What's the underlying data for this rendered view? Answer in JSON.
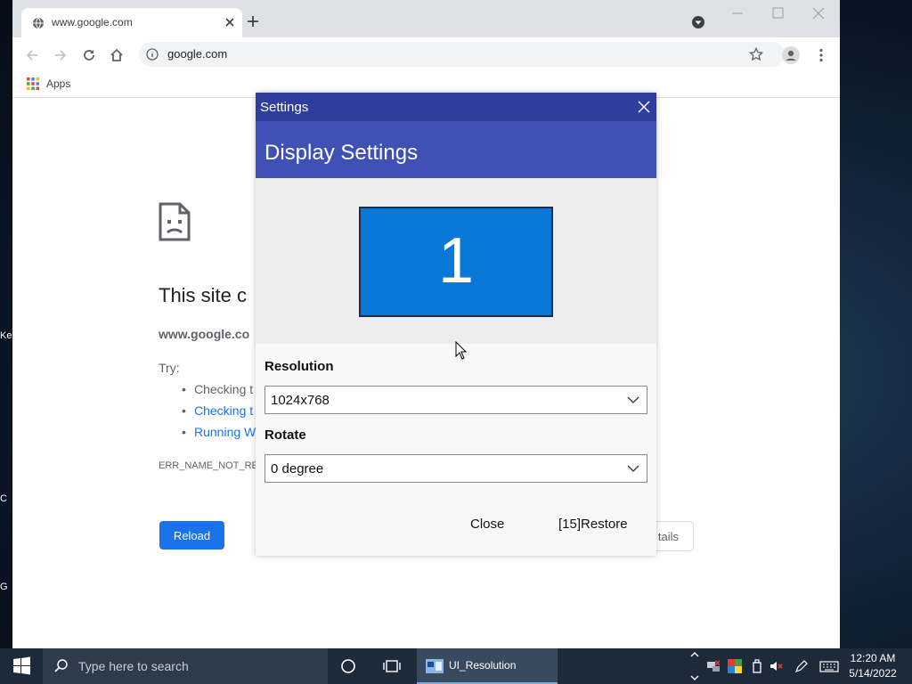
{
  "browser": {
    "tab_title": "www.google.com",
    "url": "google.com",
    "bookmarks": {
      "apps_label": "Apps"
    }
  },
  "error_page": {
    "title": "This site c",
    "host": "www.google.co",
    "try_label": "Try:",
    "suggestions": [
      "Checking t",
      "Checking t",
      "Running W"
    ],
    "error_code": "ERR_NAME_NOT_RES",
    "reload_label": "Reload",
    "details_label": "tails"
  },
  "dialog": {
    "title": "Settings",
    "heading": "Display Settings",
    "monitor_number": "1",
    "resolution_label": "Resolution",
    "resolution_value": "1024x768",
    "rotate_label": "Rotate",
    "rotate_value": "0 degree",
    "close_label": "Close",
    "restore_label": "[15]Restore"
  },
  "desktop": {
    "labels": [
      "Ke",
      "C",
      "G"
    ]
  },
  "taskbar": {
    "search_placeholder": "Type here to search",
    "app_label": "UI_Resolution",
    "time": "12:20 AM",
    "date": "5/14/2022"
  },
  "colors": {
    "dialog_titlebar": "#2f3e9e",
    "dialog_header": "#3f51b5",
    "monitor": "#0a78d7",
    "reload_button": "#1a73e8",
    "link": "#1a73e8"
  },
  "icons": {
    "tab_favicon": "globe-icon",
    "tab_close": "close-icon",
    "new_tab": "plus-icon",
    "back": "arrow-left-icon",
    "forward": "arrow-right-icon",
    "reload": "reload-icon",
    "home": "home-icon",
    "site_info": "info-icon",
    "bookmark": "star-icon",
    "profile": "profile-icon",
    "menu": "kebab-menu-icon",
    "apps": "apps-grid-icon",
    "error": "sad-document-icon",
    "dialog_close": "close-icon",
    "dropdown": "chevron-down-icon",
    "start": "windows-logo-icon",
    "search": "search-icon",
    "cortana": "cortana-circle-icon",
    "task_view": "task-view-icon"
  }
}
